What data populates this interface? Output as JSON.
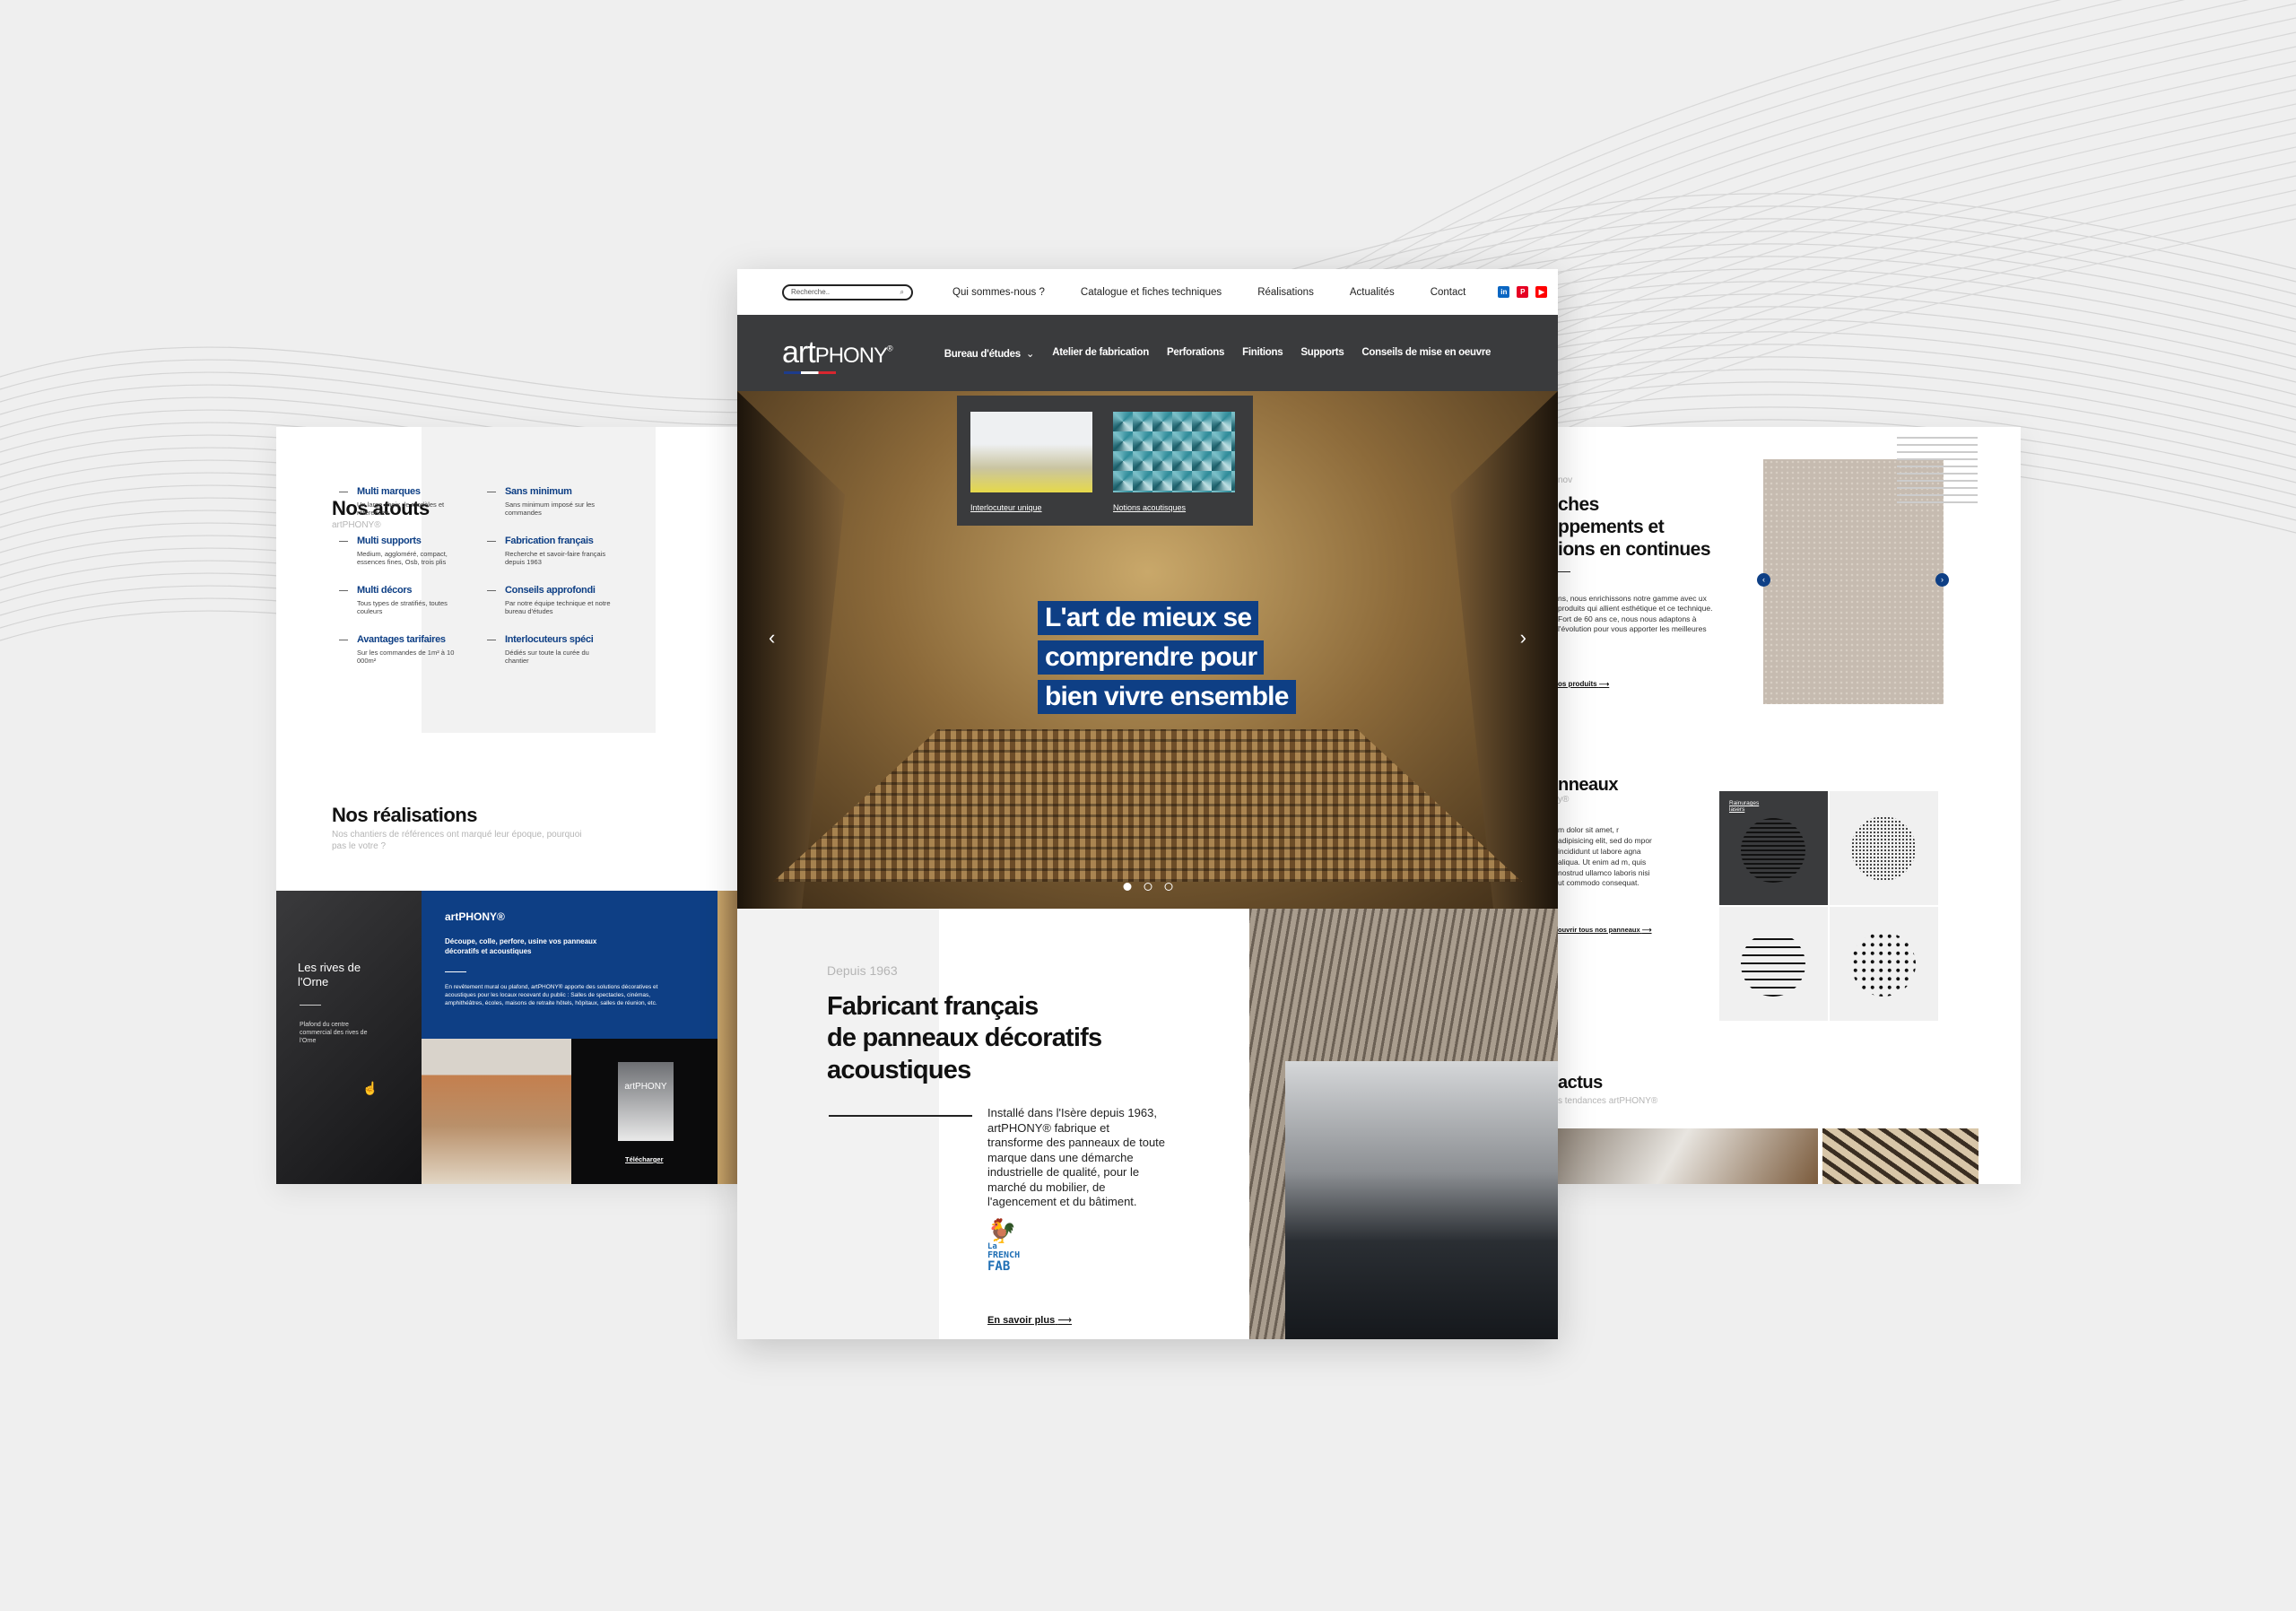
{
  "colors": {
    "brand_blue": "#0e3f85",
    "dark_nav": "#3a3b3d",
    "background": "#efefef"
  },
  "center": {
    "search": {
      "placeholder": "Recherche..",
      "icon": "search-icon"
    },
    "top_links": [
      "Qui sommes-nous ?",
      "Catalogue et fiches techniques",
      "Réalisations",
      "Actualités",
      "Contact"
    ],
    "social": [
      {
        "name": "linkedin-icon",
        "label": "in",
        "color": "#0a66c2"
      },
      {
        "name": "pinterest-icon",
        "label": "P",
        "color": "#e60023"
      },
      {
        "name": "youtube-icon",
        "label": "▶",
        "color": "#ff0000"
      }
    ],
    "logo": {
      "part1": "art",
      "part2": "PHONY",
      "mark": "®"
    },
    "nav": [
      "Bureau d'études",
      "Atelier de fabrication",
      "Perforations",
      "Finitions",
      "Supports",
      "Conseils de mise en oeuvre"
    ],
    "dropdown": [
      "Interlocuteur unique",
      "Notions acoutisques"
    ],
    "hero_lines": [
      "L'art de mieux se",
      "comprendre pour",
      "bien vivre ensemble"
    ],
    "carousel": {
      "slides": 3,
      "active": 0
    },
    "since": "Depuis 1963",
    "title_lines": [
      "Fabricant français",
      "de panneaux décoratifs",
      "acoustiques"
    ],
    "body": "Installé dans l'Isère depuis 1963, artPHONY® fabrique et transforme des panneaux de toute marque dans une démarche industrielle de qualité, pour le marché du mobilier, de l'agencement et du bâtiment.",
    "french_fab": {
      "line1": "La",
      "line2": "FRENCH",
      "line3": "FAB"
    },
    "more": "En savoir plus"
  },
  "left": {
    "atouts_title": "Nos atouts",
    "atouts_sub": "artPHONY®",
    "atouts": [
      {
        "t": "Multi marques",
        "d": "Un large choix de modèles et références"
      },
      {
        "t": "Multi supports",
        "d": "Medium, aggloméré, compact, essences fines, Osb, trois plis"
      },
      {
        "t": "Multi décors",
        "d": "Tous types de stratifiés, toutes couleurs"
      },
      {
        "t": "Avantages tarifaires",
        "d": "Sur les commandes de 1m² à 10 000m²"
      },
      {
        "t": "Sans minimum",
        "d": "Sans minimum imposé sur les commandes"
      },
      {
        "t": "Fabrication français",
        "d": "Recherche et savoir-faire français depuis 1963"
      },
      {
        "t": "Conseils approfondi",
        "d": "Par notre équipe technique et notre bureau d'études"
      },
      {
        "t": "Interlocuteurs spéci",
        "d": "Dédiés sur toute la curée du chantier"
      }
    ],
    "real_title": "Nos réalisations",
    "real_sub": "Nos chantiers de références ont marqué leur époque, pourquoi pas le votre ?",
    "project_title": "Les rives de l'Orne",
    "project_desc": "Plafond du centre commercial des rives de l'Orne",
    "blue_title": "artPHONY®",
    "blue_lead": "Découpe, colle, perfore, usine vos panneaux décoratifs et acoustiques",
    "blue_body": "En revêtement mural ou plafond, artPHONY® apporte des solutions décoratives et acoustiques pour les locaux recevant du public : Salles de spectacles, cinémas, amphithéâtres, écoles, maisons de retraite hôtels, hôpitaux, salles de réunion, etc.",
    "brochure_logo": "artPHONY",
    "download": "Télécharger"
  },
  "right": {
    "eyebrow": "nov",
    "title_lines": [
      "ches",
      "ppements et",
      "ions en continues"
    ],
    "body": "ns, nous enrichissons notre gamme avec ux produits qui allient esthétique et ce technique. Fort de 60 ans ce, nous nous adaptons à l'évolution pour vous apporter les meilleures",
    "products_link": "os produits",
    "panels_title": "nneaux",
    "panels_sub": "y®",
    "panels_body": "m dolor sit amet, r adipisicing elit, sed do mpor incididunt ut labore agna aliqua. Ut enim ad m, quis nostrud ullamco laboris nisi ut commodo consequat.",
    "panels_link": "ouvrir tous nos panneaux",
    "tile_label": "Rainurages lasers",
    "actus_title": "actus",
    "actus_sub": "s tendances artPHONY®"
  }
}
